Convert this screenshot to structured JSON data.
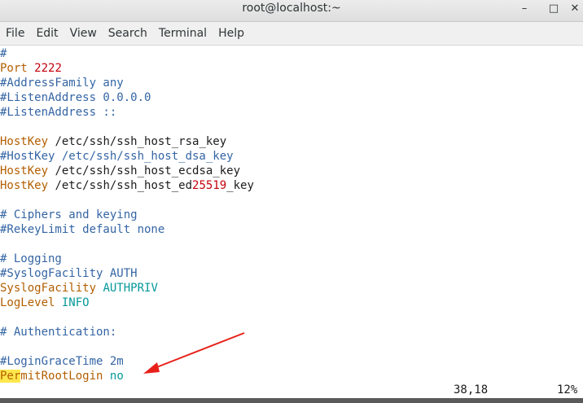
{
  "window": {
    "title": "root@localhost:~",
    "minimize_glyph": "–",
    "maximize_glyph": "□",
    "close_glyph": "✕"
  },
  "menu": [
    "File",
    "Edit",
    "View",
    "Search",
    "Terminal",
    "Help"
  ],
  "editor": {
    "lines": [
      [
        {
          "t": "#",
          "c": "com"
        }
      ],
      [
        {
          "t": "Port ",
          "c": "key"
        },
        {
          "t": "2222",
          "c": "num"
        }
      ],
      [
        {
          "t": "#AddressFamily any",
          "c": "com"
        }
      ],
      [
        {
          "t": "#ListenAddress 0.0.0.0",
          "c": "com"
        }
      ],
      [
        {
          "t": "#ListenAddress ::",
          "c": "com"
        }
      ],
      [],
      [
        {
          "t": "HostKey",
          "c": "key"
        },
        {
          "t": " /etc/ssh/ssh_host_rsa_key",
          "c": "plain"
        }
      ],
      [
        {
          "t": "#HostKey /etc/ssh/ssh_host_dsa_key",
          "c": "com"
        }
      ],
      [
        {
          "t": "HostKey",
          "c": "key"
        },
        {
          "t": " /etc/ssh/ssh_host_ecdsa_key",
          "c": "plain"
        }
      ],
      [
        {
          "t": "HostKey",
          "c": "key"
        },
        {
          "t": " /etc/ssh/ssh_host_ed",
          "c": "plain"
        },
        {
          "t": "25519",
          "c": "num"
        },
        {
          "t": "_key",
          "c": "plain"
        }
      ],
      [],
      [
        {
          "t": "# Ciphers and keying",
          "c": "com"
        }
      ],
      [
        {
          "t": "#RekeyLimit default none",
          "c": "com"
        }
      ],
      [],
      [
        {
          "t": "# Logging",
          "c": "com"
        }
      ],
      [
        {
          "t": "#SyslogFacility AUTH",
          "c": "com"
        }
      ],
      [
        {
          "t": "SyslogFacility",
          "c": "key"
        },
        {
          "t": " ",
          "c": "plain"
        },
        {
          "t": "AUTHPRIV",
          "c": "val"
        }
      ],
      [
        {
          "t": "LogLevel",
          "c": "key"
        },
        {
          "t": " ",
          "c": "plain"
        },
        {
          "t": "INFO",
          "c": "val"
        }
      ],
      [],
      [
        {
          "t": "# Authentication:",
          "c": "com"
        }
      ],
      [],
      [
        {
          "t": "#LoginGraceTime 2m",
          "c": "com"
        }
      ],
      [
        {
          "t": "Per",
          "c": "hl"
        },
        {
          "t": "mitRootLogin",
          "c": "key"
        },
        {
          "t": " ",
          "c": "plain"
        },
        {
          "t": "no",
          "c": "val"
        }
      ]
    ],
    "cursor_position": "38,18",
    "scroll_percent": "12%"
  },
  "colors": {
    "comment": "#3465a4",
    "keyword": "#b35e00",
    "number": "#c4000c",
    "value": "#06989a",
    "highlight": "#ffe84d",
    "annotation_arrow": "#e8201a"
  }
}
